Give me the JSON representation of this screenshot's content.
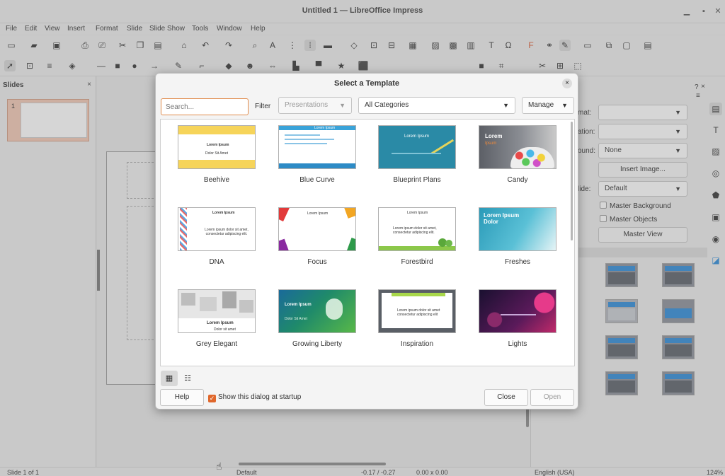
{
  "window": {
    "title": "Untitled 1 — LibreOffice Impress",
    "minimize": "▁",
    "maximize": "▪",
    "close": "✕"
  },
  "menu": [
    "File",
    "Edit",
    "View",
    "Insert",
    "Format",
    "Slide",
    "Slide Show",
    "Tools",
    "Window",
    "Help"
  ],
  "slides_pane": {
    "title": "Slides",
    "close": "×",
    "slide_number": "1"
  },
  "sidebar": {
    "format_label": "mat:",
    "orientation_label": "ation:",
    "background_label": "ound:",
    "background_value": "None",
    "insert_image": "Insert Image...",
    "master_slide_label": "lide:",
    "master_slide_value": "Default",
    "master_background": "Master Background",
    "master_objects": "Master Objects",
    "master_view": "Master View",
    "help_glyph": "?",
    "close_glyph": "×",
    "menu_glyph": "≡"
  },
  "dialog": {
    "title": "Select a Template",
    "close": "×",
    "search_placeholder": "Search...",
    "filter_label": "Filter",
    "filter_value": "Presentations",
    "category_value": "All Categories",
    "manage_label": "Manage",
    "templates": [
      "Beehive",
      "Blue Curve",
      "Blueprint Plans",
      "Candy",
      "DNA",
      "Focus",
      "Forestbird",
      "Freshes",
      "Grey Elegant",
      "Growing Liberty",
      "Inspiration",
      "Lights"
    ],
    "thumb_text": {
      "beehive_title": "Lorem Ipsum",
      "beehive_sub": "Dolor Sit Amet",
      "bluecurve_title": "Lorem Ipsum",
      "blueprint_title": "Lorem Ipsum",
      "candy_title": "Lorem",
      "candy_sub": "Ipsum",
      "dna_title": "Lorem Ipsum",
      "dna_body": "Lorem ipsum dolor sit amet, consectetur adipiscing elit.",
      "focus_title": "Lorem Ipsum",
      "forestbird_title": "Lorem Ipsum",
      "forestbird_body": "Lorem ipsum dolor sit amet, consectetur adipiscing elit.",
      "freshes_title": "Lorem Ipsum Dolor",
      "grey_title": "Lorem Ipsum",
      "grey_sub": "Dolor sit amet",
      "growing_title": "Lorem Ipsum",
      "growing_sub": "Dolor Sit Amet",
      "inspiration_body": "Lorem ipsum dolor sit amet consectetur adipiscing elit"
    },
    "help_label": "Help",
    "startup_label": "Show this dialog at startup",
    "close_label": "Close",
    "open_label": "Open",
    "thumb_view_icon": "▦",
    "list_view_icon": "☷"
  },
  "statusbar": {
    "slide": "Slide 1 of 1",
    "master": "Default",
    "position": "-0.17 / -0.27",
    "size": "0.00 x 0.00",
    "language": "English (USA)",
    "zoom": "124%"
  },
  "colors": {
    "accent": "#e0672b",
    "slide_selected": "#f3c8b4",
    "layout_blue": "#2b8ad8"
  }
}
